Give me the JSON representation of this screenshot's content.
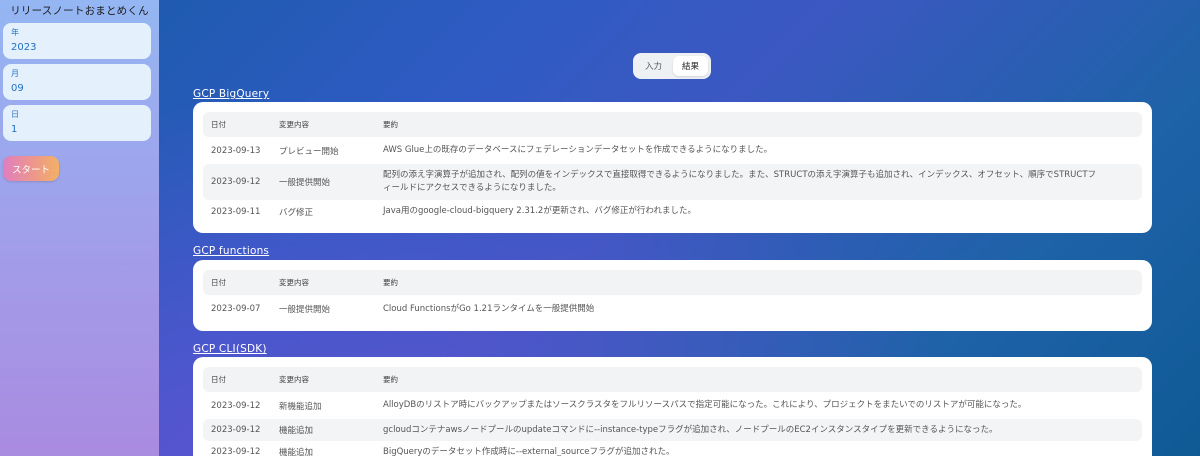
{
  "app": {
    "title": "リリースノートおまとめくん"
  },
  "form": {
    "year": {
      "label": "年",
      "value": "2023"
    },
    "month": {
      "label": "月",
      "value": "09"
    },
    "day": {
      "label": "日",
      "value": "1"
    },
    "start_label": "スタート"
  },
  "tabs": [
    {
      "label": "入力",
      "active": false
    },
    {
      "label": "結果",
      "active": true
    }
  ],
  "headers": {
    "date": "日付",
    "type": "変更内容",
    "summary": "要約"
  },
  "sections": [
    {
      "title": "GCP BigQuery",
      "rows": [
        {
          "date": "2023-09-13",
          "type": "プレビュー開始",
          "summary": "AWS Glue上の既存のデータベースにフェデレーションデータセットを作成できるようになりました。"
        },
        {
          "date": "2023-09-12",
          "type": "一般提供開始",
          "summary": "配列の添え字演算子が追加され、配列の値をインデックスで直接取得できるようになりました。また、STRUCTの添え字演算子も追加され、インデックス、オフセット、順序でSTRUCTフィールドにアクセスできるようになりました。"
        },
        {
          "date": "2023-09-11",
          "type": "バグ修正",
          "summary": "Java用のgoogle-cloud-bigquery 2.31.2が更新され、バグ修正が行われました。"
        }
      ]
    },
    {
      "title": "GCP functions",
      "rows": [
        {
          "date": "2023-09-07",
          "type": "一般提供開始",
          "summary": "Cloud FunctionsがGo 1.21ランタイムを一般提供開始"
        }
      ]
    },
    {
      "title": "GCP CLI(SDK)",
      "rows": [
        {
          "date": "2023-09-12",
          "type": "新機能追加",
          "summary": "AlloyDBのリストア時にバックアップまたはソースクラスタをフルリソースパスで指定可能になった。これにより、プロジェクトをまたいでのリストアが可能になった。"
        },
        {
          "date": "2023-09-12",
          "type": "機能追加",
          "summary": "gcloudコンテナawsノードプールのupdateコマンドに--instance-typeフラグが追加され、ノードプールのEC2インスタンスタイプを更新できるようになった。"
        },
        {
          "date": "2023-09-12",
          "type": "機能追加",
          "summary": "BigQueryのデータセット作成時に--external_sourceフラグが追加された。"
        }
      ]
    }
  ]
}
